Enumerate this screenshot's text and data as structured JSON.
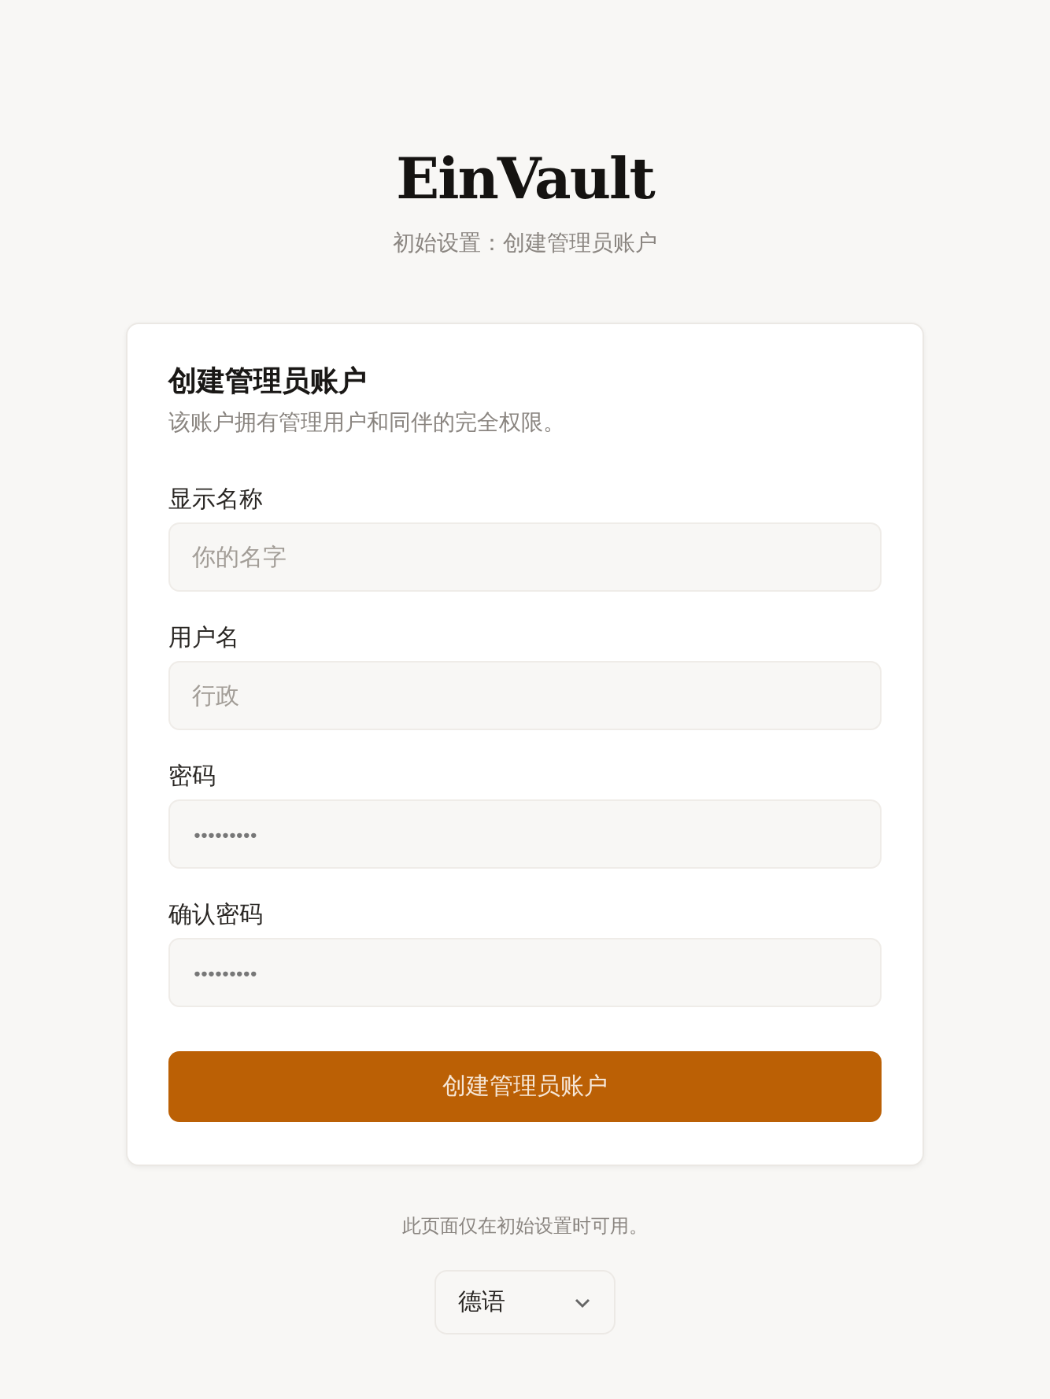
{
  "brand": {
    "name": "EinVault",
    "subtitle": "初始设置：创建管理员账户"
  },
  "card": {
    "title": "创建管理员账户",
    "description": "该账户拥有管理用户和同伴的完全权限。",
    "fields": [
      {
        "label": "显示名称",
        "placeholder": "你的名字",
        "kind": "text"
      },
      {
        "label": "用户名",
        "placeholder": "行政",
        "kind": "text"
      },
      {
        "label": "密码",
        "placeholder": "•••••••••",
        "kind": "password"
      },
      {
        "label": "确认密码",
        "placeholder": "•••••••••",
        "kind": "password"
      }
    ],
    "submit": "创建管理员账户"
  },
  "footer": {
    "note": "此页面仅在初始设置时可用。",
    "language": "德语"
  }
}
